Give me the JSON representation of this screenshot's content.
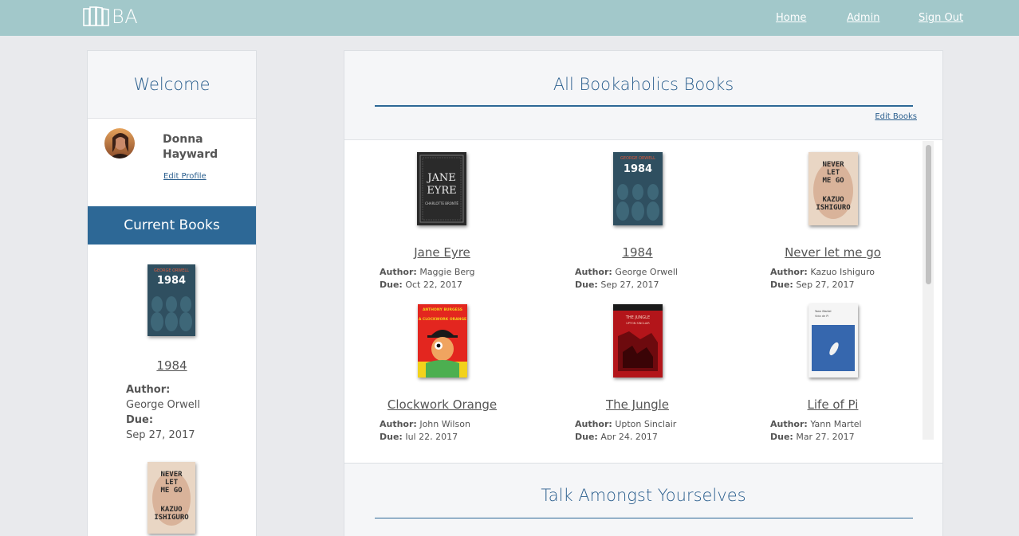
{
  "nav": {
    "logo_text": "BA",
    "home": "Home",
    "admin": "Admin",
    "sign_out": "Sign Out"
  },
  "sidebar": {
    "welcome": "Welcome",
    "user_name": "Donna Hayward",
    "edit_profile": "Edit Profile",
    "current_books_title": "Current Books",
    "current_books": [
      {
        "title": "1984",
        "author_label": "Author:",
        "author": "George Orwell",
        "due_label": "Due:",
        "due": "Sep 27, 2017"
      },
      {
        "title": "Never let me go"
      }
    ]
  },
  "main": {
    "title": "All Bookaholics Books",
    "edit_books": "Edit Books",
    "books": [
      {
        "title": "Jane Eyre",
        "author": "Maggie Berg",
        "due": "Oct 22, 2017"
      },
      {
        "title": "1984",
        "author": "George Orwell",
        "due": "Sep 27, 2017"
      },
      {
        "title": "Never let me go",
        "author": "Kazuo Ishiguro",
        "due": "Sep 27, 2017"
      },
      {
        "title": "Clockwork Orange",
        "author": "John Wilson",
        "due": "Jul 22, 2017"
      },
      {
        "title": "The Jungle",
        "author": "Upton Sinclair",
        "due": "Apr 24, 2017"
      },
      {
        "title": "Life of Pi",
        "author": "Yann Martel",
        "due": "Mar 27, 2017"
      }
    ],
    "author_label": "Author:",
    "due_label": "Due:"
  },
  "talk": {
    "title": "Talk Amongst Yourselves"
  },
  "covers": {
    "jane_eyre": {
      "line1": "JANE",
      "line2": "EYRE",
      "byline": "CHARLOTTE BRONTË"
    },
    "orwell": {
      "author": "GEORGE ORWELL",
      "title": "1984"
    },
    "ishiguro": {
      "lines": [
        "NEVER",
        "LET",
        "ME GO",
        "KAZUO",
        "ISHIGURO"
      ]
    },
    "clockwork": {
      "author": "ANTHONY BURGESS",
      "title": "A CLOCKWORK ORANGE"
    },
    "jungle": {
      "title": "THE JUNGLE",
      "author": "UPTON SINCLAIR"
    },
    "pi": {
      "author": "Yann Martel",
      "title": "Vida de Pi"
    }
  },
  "colors": {
    "topbar": "#a2c8ca",
    "accent": "#2d6896",
    "heading": "#2b5f8e",
    "background": "#e9eaed"
  }
}
